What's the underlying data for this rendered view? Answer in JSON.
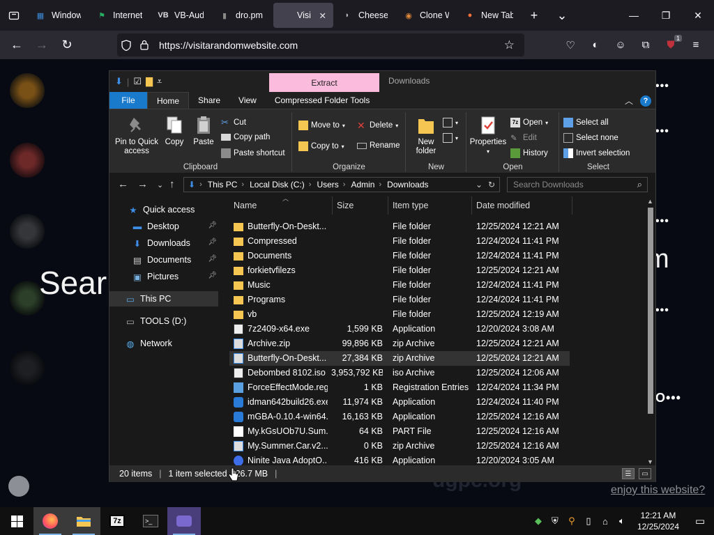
{
  "browser": {
    "tabs": [
      {
        "label": "Window",
        "icon": "windows-icon",
        "active": false
      },
      {
        "label": "Internet",
        "icon": "flag-icon",
        "active": false
      },
      {
        "label": "VB-Audi",
        "icon": "vb-icon",
        "active": false
      },
      {
        "label": "dro.pm",
        "icon": "dro-icon",
        "active": false
      },
      {
        "label": "Visit A Ra",
        "icon": "blank-page-icon",
        "active": true
      },
      {
        "label": "Cheese",
        "icon": "cheese-icon",
        "active": false
      },
      {
        "label": "Clone W",
        "icon": "clone-icon",
        "active": false
      },
      {
        "label": "New Tab",
        "icon": "firefox-icon",
        "active": false
      }
    ],
    "url": "https://visitarandomwebsite.com",
    "extension_badge": "1"
  },
  "website": {
    "heading_left": "Sear",
    "heading_right": "m",
    "dots": "•••",
    "dots_o": "O•••",
    "watermark": "ugpc.org",
    "footer_link": "enjoy this website?"
  },
  "explorer": {
    "contextual_tab": "Extract",
    "title": "Downloads",
    "ribbon_tabs": [
      "File",
      "Home",
      "Share",
      "View",
      "Compressed Folder Tools"
    ],
    "clipboard": {
      "pin": "Pin to Quick access",
      "copy": "Copy",
      "paste": "Paste",
      "cut": "Cut",
      "copy_path": "Copy path",
      "paste_shortcut": "Paste shortcut",
      "group": "Clipboard"
    },
    "organize": {
      "move_to": "Move to",
      "copy_to": "Copy to",
      "delete": "Delete",
      "rename": "Rename",
      "group": "Organize"
    },
    "new": {
      "new_folder": "New folder",
      "group": "New"
    },
    "open": {
      "properties": "Properties",
      "open": "Open",
      "edit": "Edit",
      "history": "History",
      "group": "Open"
    },
    "select": {
      "select_all": "Select all",
      "select_none": "Select none",
      "invert": "Invert selection",
      "group": "Select"
    },
    "breadcrumb": [
      "This PC",
      "Local Disk (C:)",
      "Users",
      "Admin",
      "Downloads"
    ],
    "search_placeholder": "Search Downloads",
    "nav": [
      {
        "label": "Quick access",
        "icon": "star-icon"
      },
      {
        "label": "Desktop",
        "icon": "desktop-icon",
        "pinned": true
      },
      {
        "label": "Downloads",
        "icon": "downloads-icon",
        "pinned": true
      },
      {
        "label": "Documents",
        "icon": "documents-icon",
        "pinned": true
      },
      {
        "label": "Pictures",
        "icon": "pictures-icon",
        "pinned": true
      },
      {
        "label": "This PC",
        "icon": "pc-icon"
      },
      {
        "label": "TOOLS (D:)",
        "icon": "drive-icon"
      },
      {
        "label": "Network",
        "icon": "network-icon"
      }
    ],
    "columns": [
      "Name",
      "Size",
      "Item type",
      "Date modified"
    ],
    "files": [
      {
        "name": "Butterfly-On-Deskt...",
        "size": "",
        "type": "File folder",
        "date": "12/25/2024 12:21 AM",
        "icon": "folder"
      },
      {
        "name": "Compressed",
        "size": "",
        "type": "File folder",
        "date": "12/24/2024 11:41 PM",
        "icon": "folder"
      },
      {
        "name": "Documents",
        "size": "",
        "type": "File folder",
        "date": "12/24/2024 11:41 PM",
        "icon": "folder"
      },
      {
        "name": "forkietvfilezs",
        "size": "",
        "type": "File folder",
        "date": "12/25/2024 12:21 AM",
        "icon": "folder"
      },
      {
        "name": "Music",
        "size": "",
        "type": "File folder",
        "date": "12/24/2024 11:41 PM",
        "icon": "folder"
      },
      {
        "name": "Programs",
        "size": "",
        "type": "File folder",
        "date": "12/24/2024 11:41 PM",
        "icon": "folder"
      },
      {
        "name": "vb",
        "size": "",
        "type": "File folder",
        "date": "12/25/2024 12:19 AM",
        "icon": "folder"
      },
      {
        "name": "7z2409-x64.exe",
        "size": "1,599 KB",
        "type": "Application",
        "date": "12/20/2024 3:08 AM",
        "icon": "7z"
      },
      {
        "name": "Archive.zip",
        "size": "99,896 KB",
        "type": "zip Archive",
        "date": "12/25/2024 12:21 AM",
        "icon": "zip"
      },
      {
        "name": "Butterfly-On-Deskt...",
        "size": "27,384 KB",
        "type": "zip Archive",
        "date": "12/25/2024 12:21 AM",
        "icon": "zip"
      },
      {
        "name": "Debombed 8102.iso",
        "size": "3,953,792 KB",
        "type": "iso Archive",
        "date": "12/25/2024 12:06 AM",
        "icon": "iso"
      },
      {
        "name": "ForceEffectMode.reg",
        "size": "1 KB",
        "type": "Registration Entries",
        "date": "12/24/2024 11:34 PM",
        "icon": "reg"
      },
      {
        "name": "idman642build26.exe",
        "size": "11,974 KB",
        "type": "Application",
        "date": "12/24/2024 11:40 PM",
        "icon": "exe"
      },
      {
        "name": "mGBA-0.10.4-win64...",
        "size": "16,163 KB",
        "type": "Application",
        "date": "12/25/2024 12:16 AM",
        "icon": "exe"
      },
      {
        "name": "My.kGsUOb7U.Sum...",
        "size": "64 KB",
        "type": "PART File",
        "date": "12/25/2024 12:16 AM",
        "icon": "blank"
      },
      {
        "name": "My.Summer.Car.v2...",
        "size": "0 KB",
        "type": "zip Archive",
        "date": "12/25/2024 12:16 AM",
        "icon": "zip"
      },
      {
        "name": "Ninite Java AdoptO...",
        "size": "416 KB",
        "type": "Application",
        "date": "12/20/2024 3:05 AM",
        "icon": "ninite"
      }
    ],
    "selected_index": 9,
    "status": {
      "items": "20 items",
      "selected": "1 item selected",
      "size": "26.7 MB"
    }
  },
  "taskbar": {
    "time": "12:21 AM",
    "date": "12/25/2024"
  },
  "colors": {
    "accent": "#1979ca",
    "extract_tab": "#fbbbdd",
    "folder": "#f5c652"
  }
}
